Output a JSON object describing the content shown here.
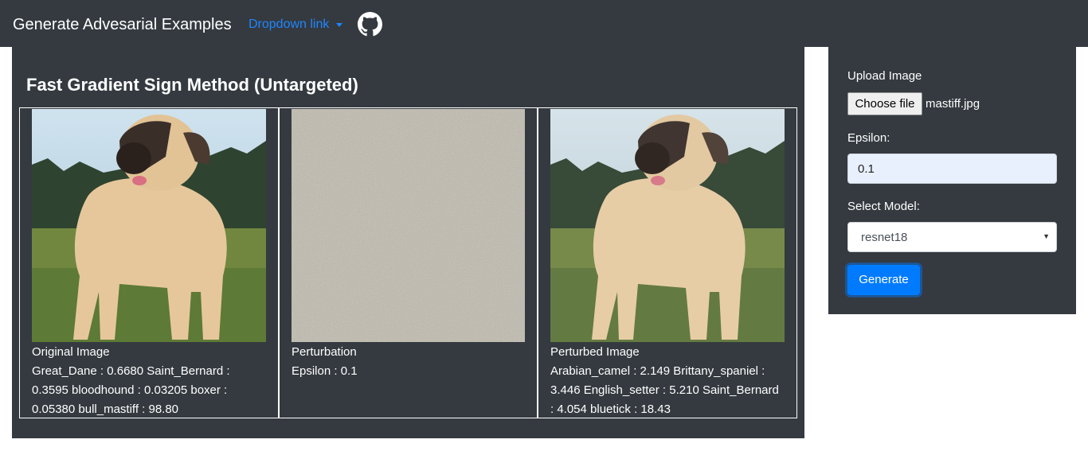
{
  "navbar": {
    "brand": "Generate Advesarial Examples",
    "dropdown_label": "Dropdown link",
    "github_icon": "github-icon"
  },
  "main": {
    "title": "Fast Gradient Sign Method (Untargeted)",
    "columns": [
      {
        "heading": "Original Image",
        "lines": [
          "Great_Dane : 0.6680 Saint_Bernard :",
          "0.3595 bloodhound : 0.03205 boxer :",
          "0.05380 bull_mastiff : 98.80"
        ]
      },
      {
        "heading": "Perturbation",
        "lines": [
          "Epsilon : 0.1"
        ]
      },
      {
        "heading": "Perturbed Image",
        "lines": [
          "Arabian_camel : 2.149 Brittany_spaniel :",
          "3.446 English_setter : 5.210 Saint_Bernard",
          ": 4.054 bluetick : 18.43"
        ]
      }
    ]
  },
  "sidebar": {
    "upload_label": "Upload Image",
    "choose_file": "Choose file",
    "file_name": "mastiff.jpg",
    "epsilon_label": "Epsilon:",
    "epsilon_value": "0.1",
    "model_label": "Select Model:",
    "model_value": "resnet18",
    "generate_label": "Generate"
  },
  "colors": {
    "panel": "#343a40",
    "accent": "#007bff",
    "link": "#1e86ff"
  }
}
